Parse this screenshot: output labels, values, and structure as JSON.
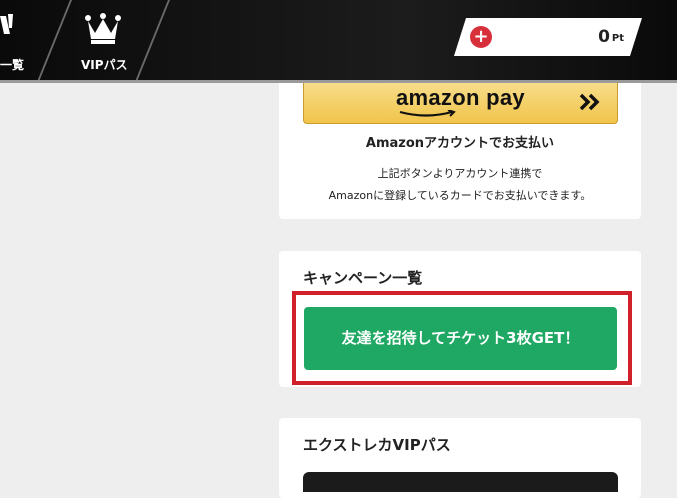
{
  "header": {
    "nav_items": [
      {
        "label": "一覧",
        "icon": "list-icon"
      },
      {
        "label": "VIPパス",
        "icon": "crown-icon"
      }
    ],
    "points": {
      "value": "0",
      "unit": "Pt",
      "add_icon": "plus-icon"
    }
  },
  "payment": {
    "amazon_button_text": "amazon pay",
    "amazon_label": "Amazonアカウントでお支払い",
    "note_line1": "上記ボタンよりアカウント連携で",
    "note_line2": "Amazonに登録しているカードでお支払いできます。"
  },
  "campaign": {
    "title": "キャンペーン一覧",
    "invite_button": "友達を招待してチケット3枚GET！"
  },
  "vip": {
    "title": "エクストレカVIPパス"
  },
  "colors": {
    "green": "#1ea863",
    "highlight_red": "#d0202a",
    "plus_red": "#d8303a"
  }
}
